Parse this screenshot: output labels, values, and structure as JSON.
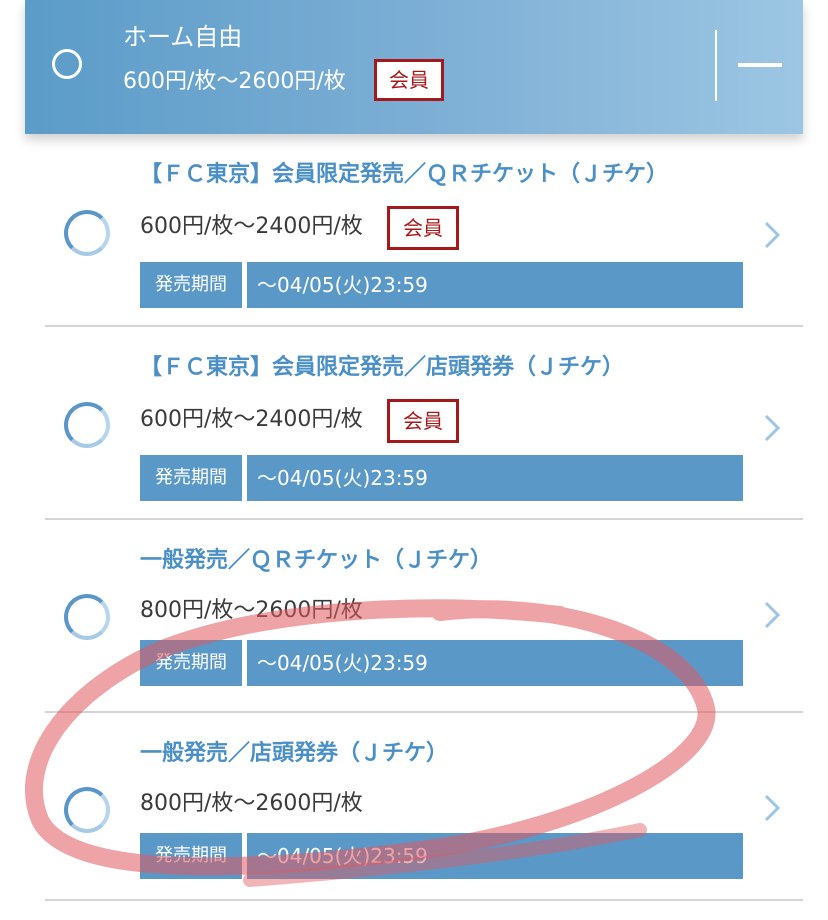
{
  "header": {
    "title": "ホーム自由",
    "price": "600円/枚〜2600円/枚",
    "badge": "会員"
  },
  "items": [
    {
      "name": "【ＦＣ東京】会員限定発売／ＱＲチケット（Ｊチケ）",
      "price": "600円/枚〜2400円/枚",
      "badge": "会員",
      "period_label": "発売期間",
      "period_value": "〜04/05(火)23:59"
    },
    {
      "name": "【ＦＣ東京】会員限定発売／店頭発券（Ｊチケ）",
      "price": "600円/枚〜2400円/枚",
      "badge": "会員",
      "period_label": "発売期間",
      "period_value": "〜04/05(火)23:59"
    },
    {
      "name": "一般発売／ＱＲチケット（Ｊチケ）",
      "price": "800円/枚〜2600円/枚",
      "period_label": "発売期間",
      "period_value": "〜04/05(火)23:59"
    },
    {
      "name": "一般発売／店頭発券（Ｊチケ）",
      "price": "800円/枚〜2600円/枚",
      "period_label": "発売期間",
      "period_value": "〜04/05(火)23:59"
    }
  ],
  "colors": {
    "accent": "#5a98c8",
    "member_badge": "#a41a1a",
    "marker": "#e05a5f"
  }
}
